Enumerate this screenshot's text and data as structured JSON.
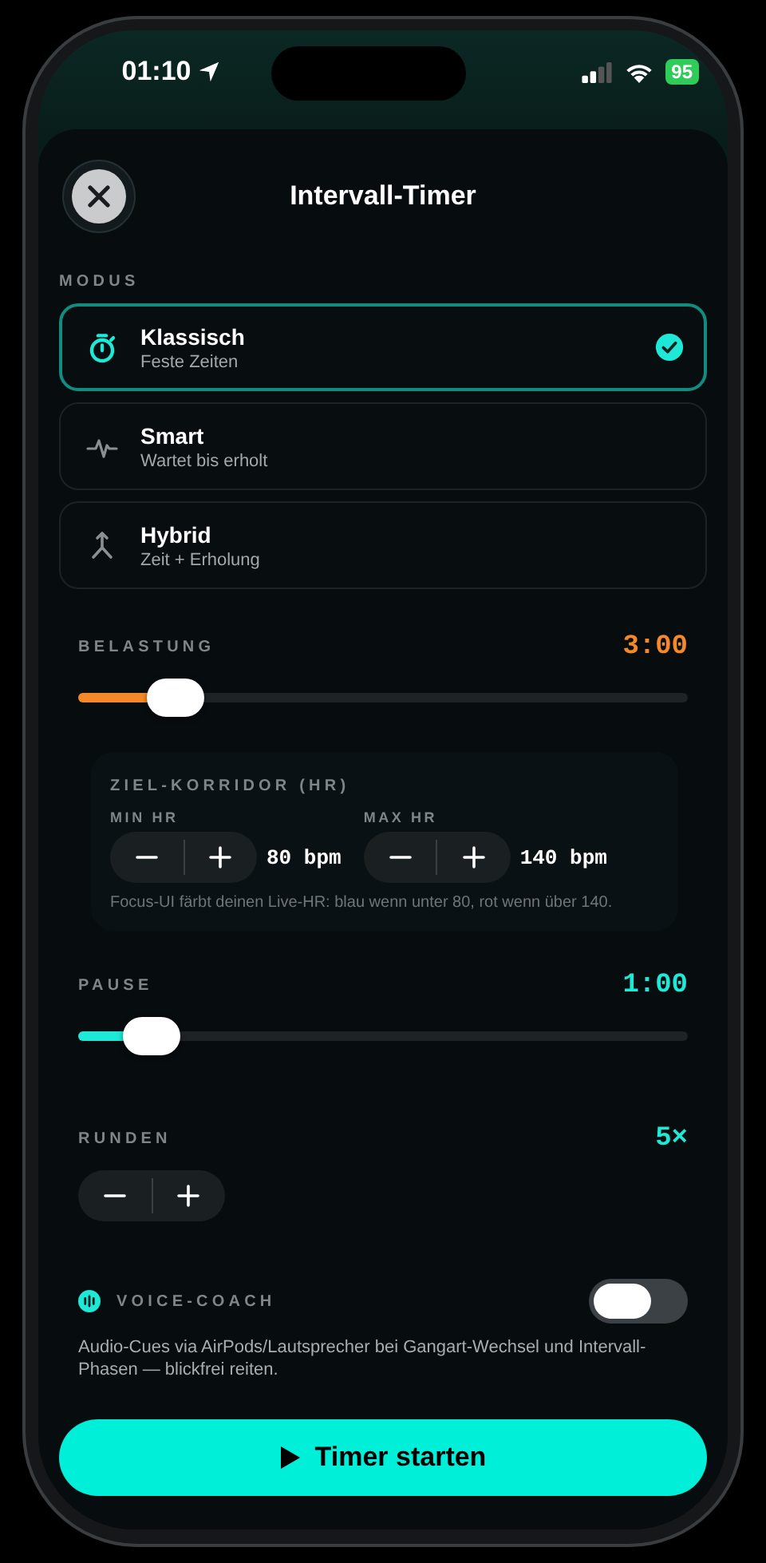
{
  "status_bar": {
    "time": "01:10",
    "battery": "95"
  },
  "header": {
    "title": "Intervall-Timer"
  },
  "mode_section": {
    "label": "MODUS"
  },
  "modes": [
    {
      "kind": "stopwatch",
      "title": "Klassisch",
      "subtitle": "Feste Zeiten",
      "selected": true
    },
    {
      "kind": "pulse",
      "title": "Smart",
      "subtitle": "Wartet bis erholt",
      "selected": false
    },
    {
      "kind": "merge",
      "title": "Hybrid",
      "subtitle": "Zeit + Erholung",
      "selected": false
    }
  ],
  "load": {
    "label": "BELASTUNG",
    "value": "3:00",
    "level": 0.16,
    "color": "#f5892a"
  },
  "hr_corridor": {
    "title": "ZIEL-KORRIDOR (HR)",
    "limits": [
      {
        "label": "MIN HR",
        "value": "80 bpm"
      },
      {
        "label": "MAX HR",
        "value": "140 bpm"
      }
    ],
    "note": "Focus-UI färbt deinen Live-HR: blau wenn unter 80, rot wenn über 140."
  },
  "pause": {
    "label": "PAUSE",
    "value": "1:00",
    "level": 0.12,
    "color": "#1de9d6"
  },
  "rounds": {
    "label": "RUNDEN",
    "value": "5×"
  },
  "voice_coach": {
    "label": "VOICE-COACH",
    "on": false,
    "description": "Audio-Cues via AirPods/Lautsprecher bei Gangart-Wechsel und Intervall-Phasen — blickfrei reiten."
  },
  "start_button": {
    "label": "Timer starten"
  }
}
